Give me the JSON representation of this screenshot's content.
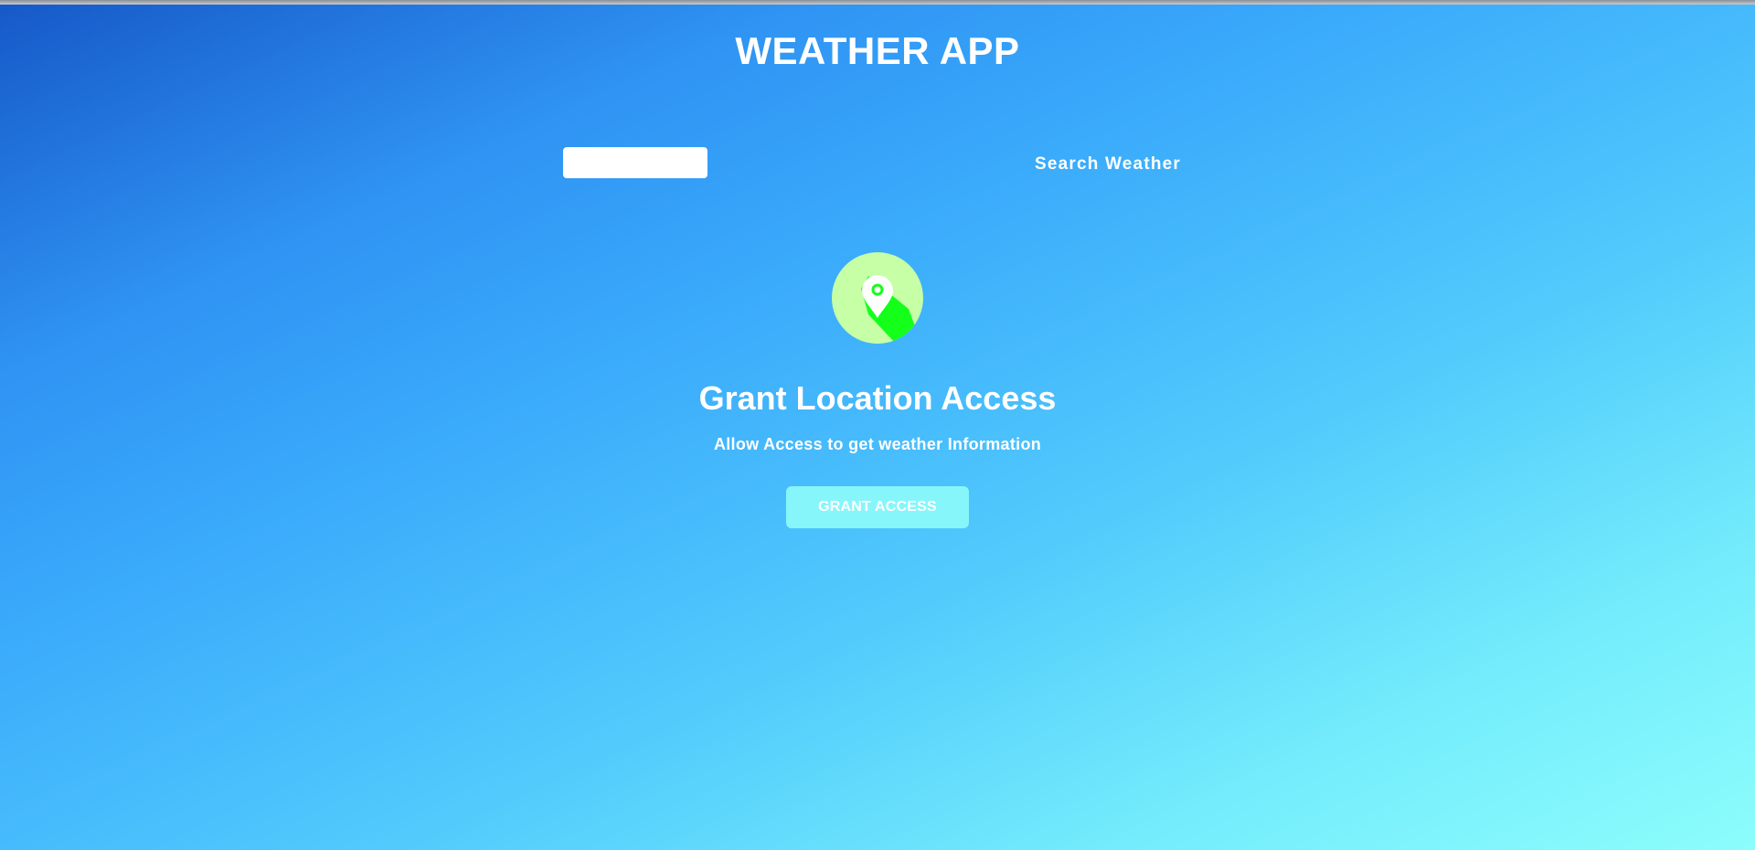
{
  "header": {
    "title": "WEATHER APP"
  },
  "search": {
    "input_value": "",
    "placeholder": "",
    "tab_label": "Search Weather"
  },
  "grant": {
    "icon": "location-pin-icon",
    "title": "Grant Location Access",
    "subtitle": "Allow Access to get weather Information",
    "button_label": "GRANT ACCESS"
  },
  "colors": {
    "background_start": "#1659c8",
    "background_end": "#8cfdfc",
    "icon_circle": "#c6ffa6",
    "icon_shadow": "#14ff1a",
    "button": "#87f6fb",
    "text": "#ffffff"
  }
}
